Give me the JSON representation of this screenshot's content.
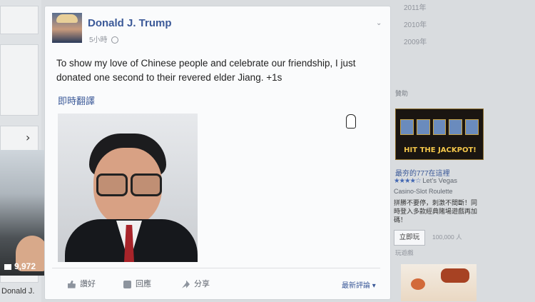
{
  "left_column": {
    "count": "9,972",
    "name": "Donald J."
  },
  "post": {
    "author": "Donald J. Trump",
    "time": "5小時",
    "text": "To show my love of Chinese people and celebrate our friendship, I just donated one second to their revered elder Jiang. +1s",
    "translate_link": "即時翻譯",
    "actions": {
      "like": "讚好",
      "comment": "回應",
      "share": "分享"
    },
    "latest_comments": "最新評論"
  },
  "right_column": {
    "years": [
      "2011年",
      "2010年",
      "2009年"
    ],
    "sponsored": "贊助",
    "ad": {
      "image_text": "HIT THE JACKPOT!",
      "title": "最夯的777在這裡",
      "stars": "★★★★☆",
      "rating_text": "Let's Vegas",
      "subtitle": "Casino-Slot Roulette",
      "description": "拼勝不要停，刺激不間斷！同時登入多款經典賭場遊戲再加碼！",
      "cta": "立即玩",
      "count": "100,000 人",
      "play": "玩遊戲"
    }
  },
  "icons": [
    "globe-icon",
    "chevron-right-icon",
    "like-icon",
    "comment-icon",
    "share-icon",
    "comment-count-icon",
    "cursor-icon"
  ],
  "colors": {
    "link": "#3b5998",
    "background": "#d9dcdf",
    "card": "#fafbfc"
  }
}
